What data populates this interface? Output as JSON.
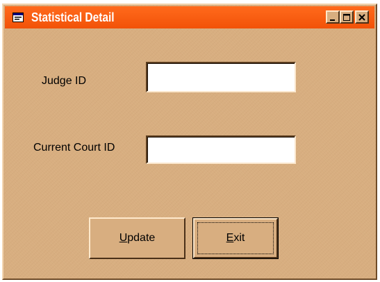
{
  "window": {
    "title": "Statistical Detail",
    "icon": "window-app-icon",
    "colors": {
      "titlebar": "#f25208",
      "body": "#d8ae80",
      "title_text": "#ffffff"
    },
    "caption_buttons": {
      "minimize": "minimize-icon",
      "maximize": "maximize-icon",
      "close": "close-icon"
    }
  },
  "form": {
    "judge_id": {
      "label": "Judge ID",
      "value": ""
    },
    "current_court_id": {
      "label": "Current Court ID",
      "value": ""
    }
  },
  "buttons": {
    "update": {
      "mnemonic": "U",
      "rest": "pdate"
    },
    "exit": {
      "mnemonic": "E",
      "rest": "xit"
    }
  }
}
